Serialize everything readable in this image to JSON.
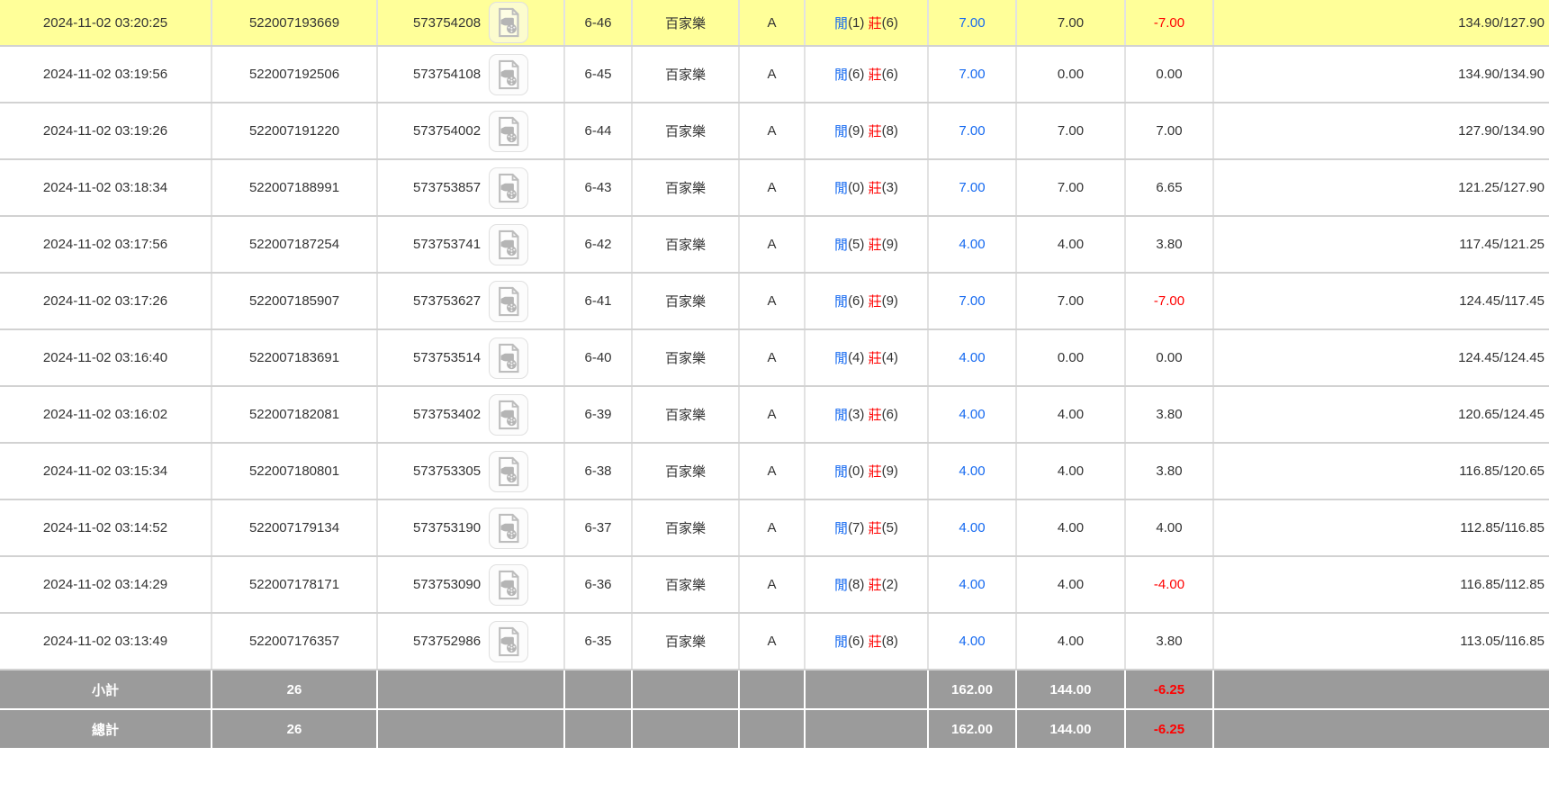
{
  "colors": {
    "highlight_row": "#ffff99",
    "accent_blue": "#1569f0",
    "accent_red": "#ff0000",
    "footer_bg": "#9b9b9b",
    "footer_text": "#ffffff"
  },
  "icons": {
    "video_replay": "video-file-icon"
  },
  "table": {
    "rows": [
      {
        "time": "2024-11-02 03:20:25",
        "bet_id": "522007193669",
        "game_serial": "573754208",
        "round": "6-46",
        "game": "百家樂",
        "table": "A",
        "player_label": "閒",
        "player_score": "(1)",
        "banker_label": "莊",
        "banker_score": "(6)",
        "stake": "7.00",
        "valid_bet": "7.00",
        "win_loss": "-7.00",
        "balance": "134.90/127.90",
        "highlighted": true
      },
      {
        "time": "2024-11-02 03:19:56",
        "bet_id": "522007192506",
        "game_serial": "573754108",
        "round": "6-45",
        "game": "百家樂",
        "table": "A",
        "player_label": "閒",
        "player_score": "(6)",
        "banker_label": "莊",
        "banker_score": "(6)",
        "stake": "7.00",
        "valid_bet": "0.00",
        "win_loss": "0.00",
        "balance": "134.90/134.90",
        "highlighted": false
      },
      {
        "time": "2024-11-02 03:19:26",
        "bet_id": "522007191220",
        "game_serial": "573754002",
        "round": "6-44",
        "game": "百家樂",
        "table": "A",
        "player_label": "閒",
        "player_score": "(9)",
        "banker_label": "莊",
        "banker_score": "(8)",
        "stake": "7.00",
        "valid_bet": "7.00",
        "win_loss": "7.00",
        "balance": "127.90/134.90",
        "highlighted": false
      },
      {
        "time": "2024-11-02 03:18:34",
        "bet_id": "522007188991",
        "game_serial": "573753857",
        "round": "6-43",
        "game": "百家樂",
        "table": "A",
        "player_label": "閒",
        "player_score": "(0)",
        "banker_label": "莊",
        "banker_score": "(3)",
        "stake": "7.00",
        "valid_bet": "7.00",
        "win_loss": "6.65",
        "balance": "121.25/127.90",
        "highlighted": false
      },
      {
        "time": "2024-11-02 03:17:56",
        "bet_id": "522007187254",
        "game_serial": "573753741",
        "round": "6-42",
        "game": "百家樂",
        "table": "A",
        "player_label": "閒",
        "player_score": "(5)",
        "banker_label": "莊",
        "banker_score": "(9)",
        "stake": "4.00",
        "valid_bet": "4.00",
        "win_loss": "3.80",
        "balance": "117.45/121.25",
        "highlighted": false
      },
      {
        "time": "2024-11-02 03:17:26",
        "bet_id": "522007185907",
        "game_serial": "573753627",
        "round": "6-41",
        "game": "百家樂",
        "table": "A",
        "player_label": "閒",
        "player_score": "(6)",
        "banker_label": "莊",
        "banker_score": "(9)",
        "stake": "7.00",
        "valid_bet": "7.00",
        "win_loss": "-7.00",
        "balance": "124.45/117.45",
        "highlighted": false
      },
      {
        "time": "2024-11-02 03:16:40",
        "bet_id": "522007183691",
        "game_serial": "573753514",
        "round": "6-40",
        "game": "百家樂",
        "table": "A",
        "player_label": "閒",
        "player_score": "(4)",
        "banker_label": "莊",
        "banker_score": "(4)",
        "stake": "4.00",
        "valid_bet": "0.00",
        "win_loss": "0.00",
        "balance": "124.45/124.45",
        "highlighted": false
      },
      {
        "time": "2024-11-02 03:16:02",
        "bet_id": "522007182081",
        "game_serial": "573753402",
        "round": "6-39",
        "game": "百家樂",
        "table": "A",
        "player_label": "閒",
        "player_score": "(3)",
        "banker_label": "莊",
        "banker_score": "(6)",
        "stake": "4.00",
        "valid_bet": "4.00",
        "win_loss": "3.80",
        "balance": "120.65/124.45",
        "highlighted": false
      },
      {
        "time": "2024-11-02 03:15:34",
        "bet_id": "522007180801",
        "game_serial": "573753305",
        "round": "6-38",
        "game": "百家樂",
        "table": "A",
        "player_label": "閒",
        "player_score": "(0)",
        "banker_label": "莊",
        "banker_score": "(9)",
        "stake": "4.00",
        "valid_bet": "4.00",
        "win_loss": "3.80",
        "balance": "116.85/120.65",
        "highlighted": false
      },
      {
        "time": "2024-11-02 03:14:52",
        "bet_id": "522007179134",
        "game_serial": "573753190",
        "round": "6-37",
        "game": "百家樂",
        "table": "A",
        "player_label": "閒",
        "player_score": "(7)",
        "banker_label": "莊",
        "banker_score": "(5)",
        "stake": "4.00",
        "valid_bet": "4.00",
        "win_loss": "4.00",
        "balance": "112.85/116.85",
        "highlighted": false
      },
      {
        "time": "2024-11-02 03:14:29",
        "bet_id": "522007178171",
        "game_serial": "573753090",
        "round": "6-36",
        "game": "百家樂",
        "table": "A",
        "player_label": "閒",
        "player_score": "(8)",
        "banker_label": "莊",
        "banker_score": "(2)",
        "stake": "4.00",
        "valid_bet": "4.00",
        "win_loss": "-4.00",
        "balance": "116.85/112.85",
        "highlighted": false
      },
      {
        "time": "2024-11-02 03:13:49",
        "bet_id": "522007176357",
        "game_serial": "573752986",
        "round": "6-35",
        "game": "百家樂",
        "table": "A",
        "player_label": "閒",
        "player_score": "(6)",
        "banker_label": "莊",
        "banker_score": "(8)",
        "stake": "4.00",
        "valid_bet": "4.00",
        "win_loss": "3.80",
        "balance": "113.05/116.85",
        "highlighted": false
      }
    ],
    "footer": [
      {
        "label": "小計",
        "count": "26",
        "stake": "162.00",
        "valid_bet": "144.00",
        "win_loss": "-6.25"
      },
      {
        "label": "總計",
        "count": "26",
        "stake": "162.00",
        "valid_bet": "144.00",
        "win_loss": "-6.25"
      }
    ]
  }
}
